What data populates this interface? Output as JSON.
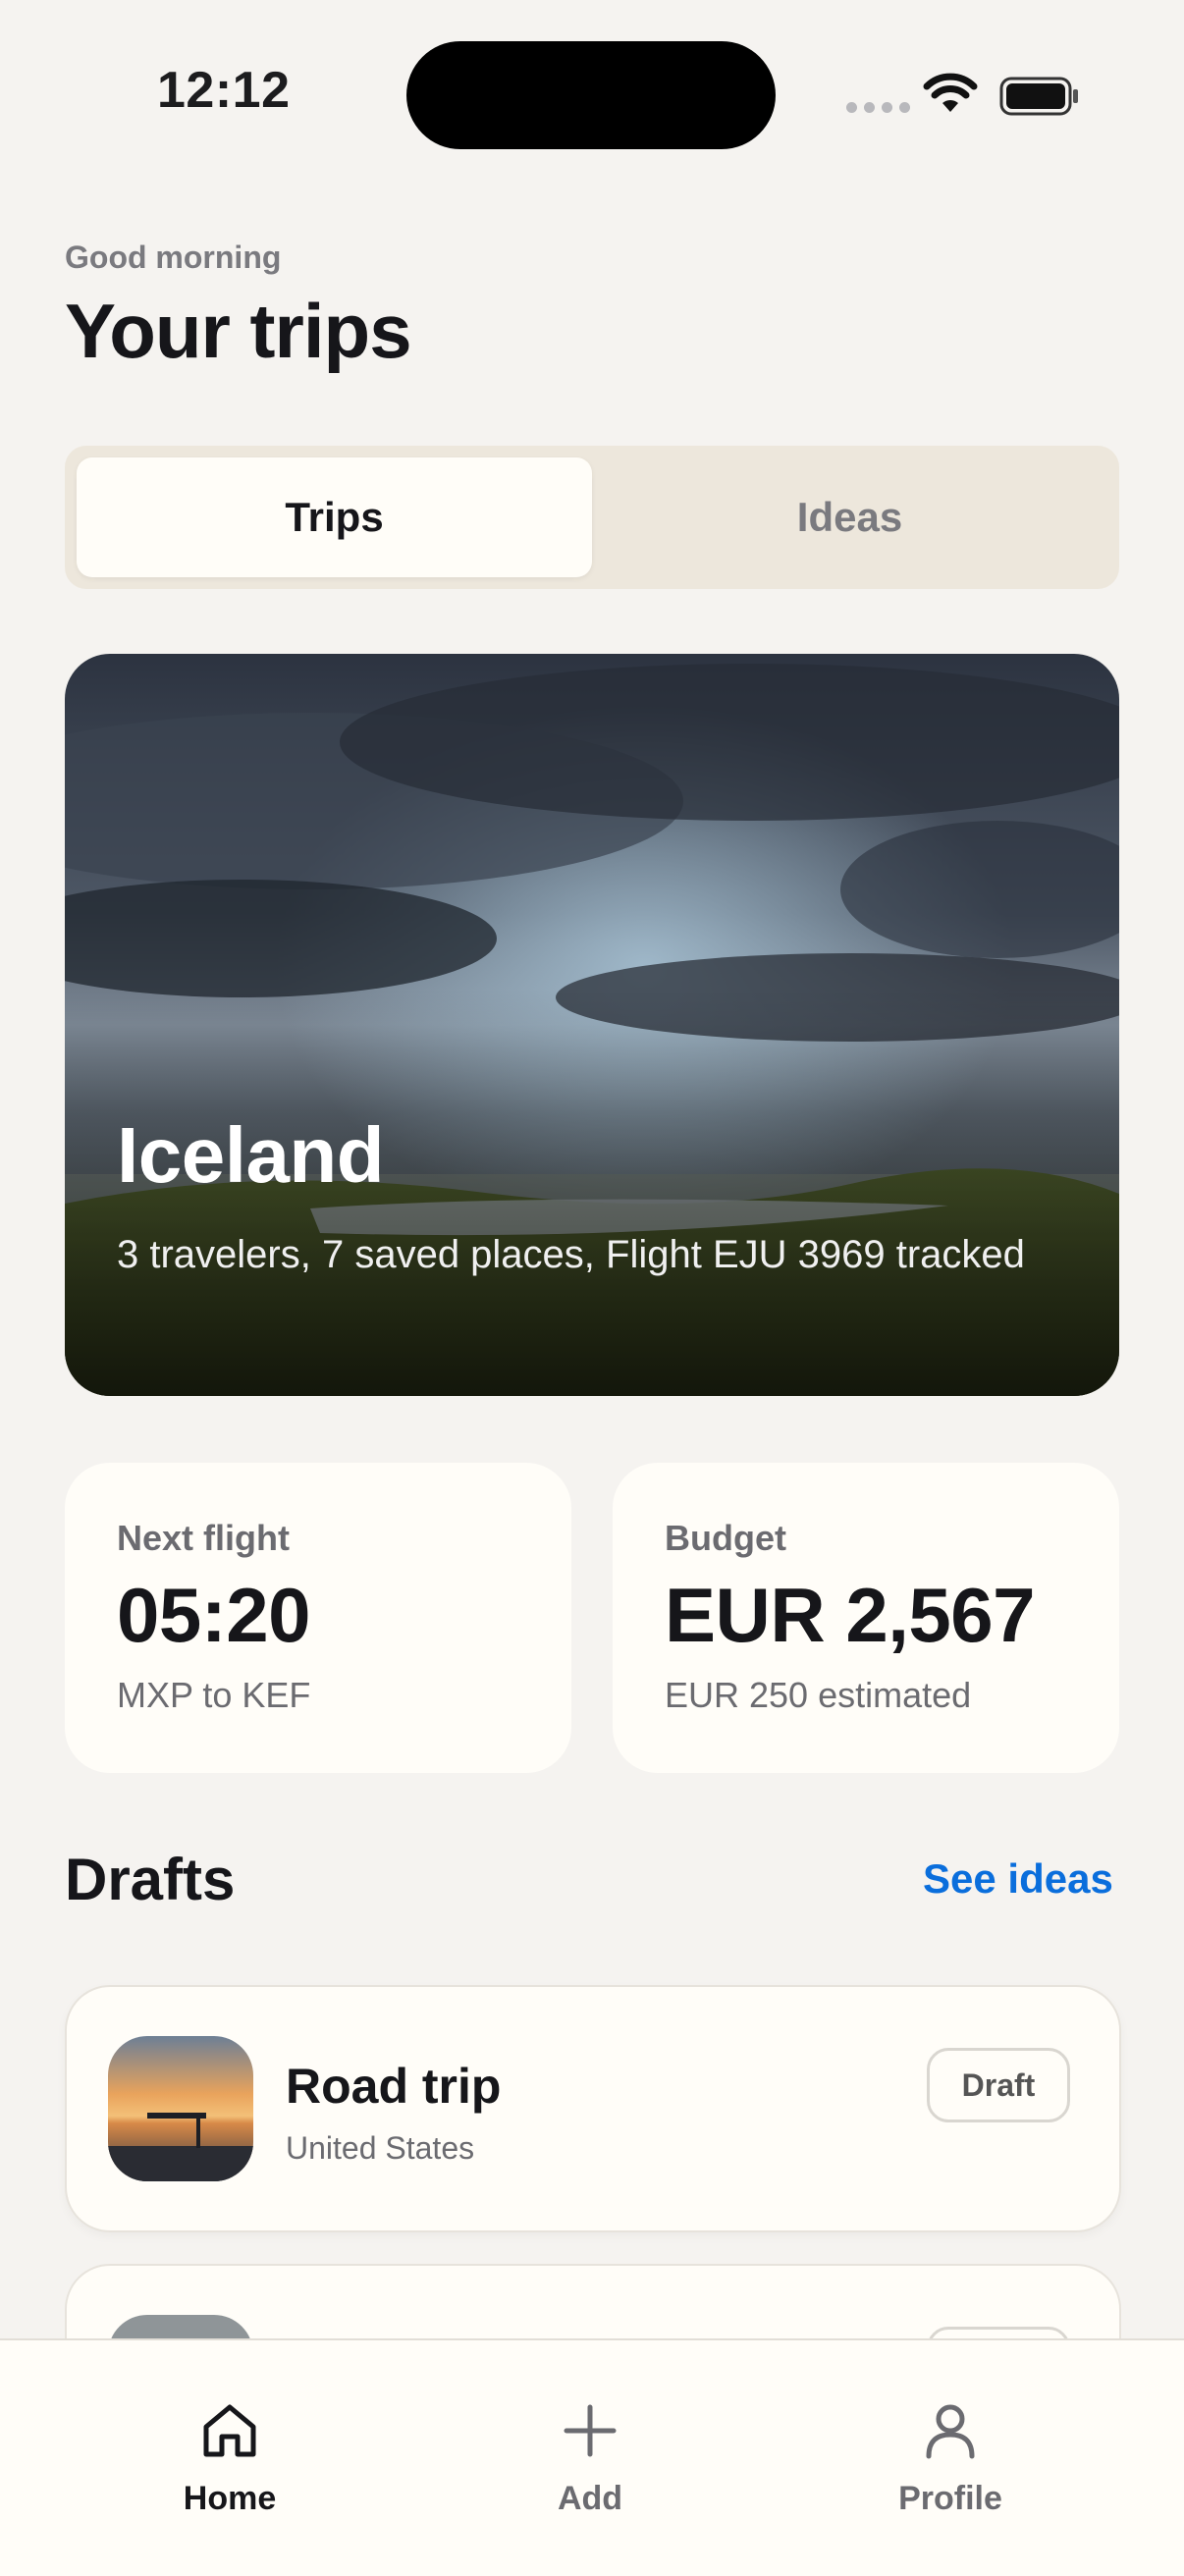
{
  "status_bar": {
    "time": "12:12"
  },
  "header": {
    "greeting": "Good morning",
    "title": "Your trips"
  },
  "segmented": {
    "options": [
      "Trips",
      "Ideas"
    ],
    "selected": "Trips"
  },
  "hero": {
    "title": "Iceland",
    "subtitle": "3 travelers, 7 saved places, Flight EJU 3969 tracked"
  },
  "stats": [
    {
      "label": "Next flight",
      "value": "05:20",
      "note": "MXP to KEF"
    },
    {
      "label": "Budget",
      "value": "EUR 2,567",
      "note": "EUR 250 estimated"
    }
  ],
  "drafts": {
    "title": "Drafts",
    "link": "See ideas",
    "items": [
      {
        "title": "Road trip",
        "subtitle": "United States",
        "badge": "Draft"
      }
    ]
  },
  "tabbar": {
    "items": [
      {
        "label": "Home",
        "icon": "home-icon",
        "active": true
      },
      {
        "label": "Add",
        "icon": "plus-icon",
        "active": false
      },
      {
        "label": "Profile",
        "icon": "person-icon",
        "active": false
      }
    ]
  },
  "colors": {
    "accent": "#0a6edc",
    "background": "#f5f3f0",
    "card": "#fffdf8"
  }
}
